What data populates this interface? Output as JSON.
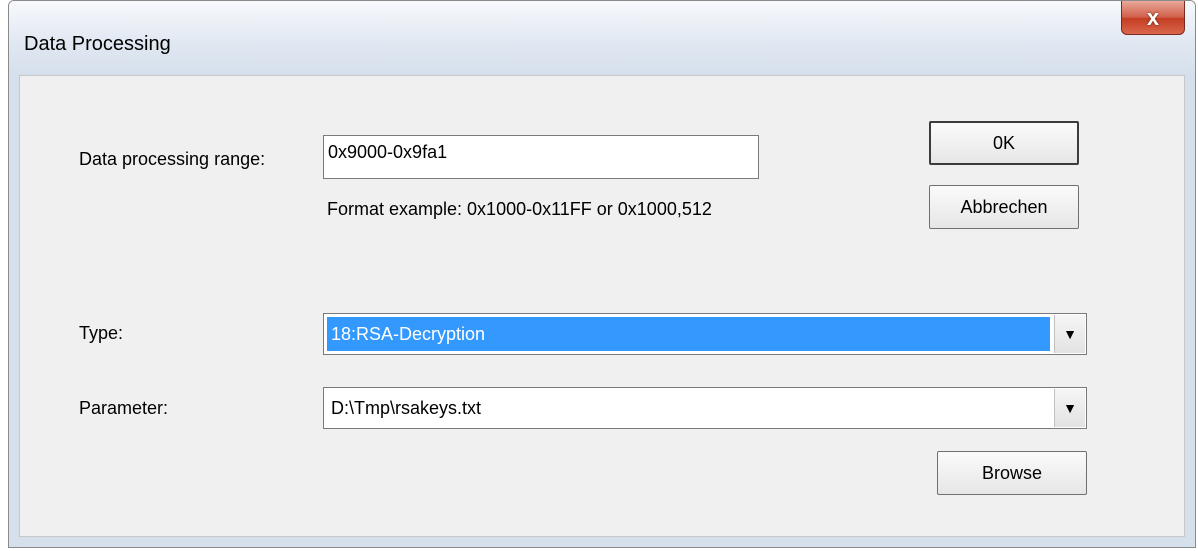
{
  "window": {
    "title": "Data Processing",
    "close_label": "x"
  },
  "range": {
    "label": "Data processing range:",
    "value": "0x9000-0x9fa1",
    "hint": "Format example: 0x1000-0x11FF or 0x1000,512"
  },
  "buttons": {
    "ok": "0K",
    "cancel": "Abbrechen",
    "browse": "Browse"
  },
  "type": {
    "label": "Type:",
    "selected": "18:RSA-Decryption"
  },
  "parameter": {
    "label": "Parameter:",
    "value": "D:\\Tmp\\rsakeys.txt"
  },
  "icons": {
    "dropdown": "▼"
  }
}
